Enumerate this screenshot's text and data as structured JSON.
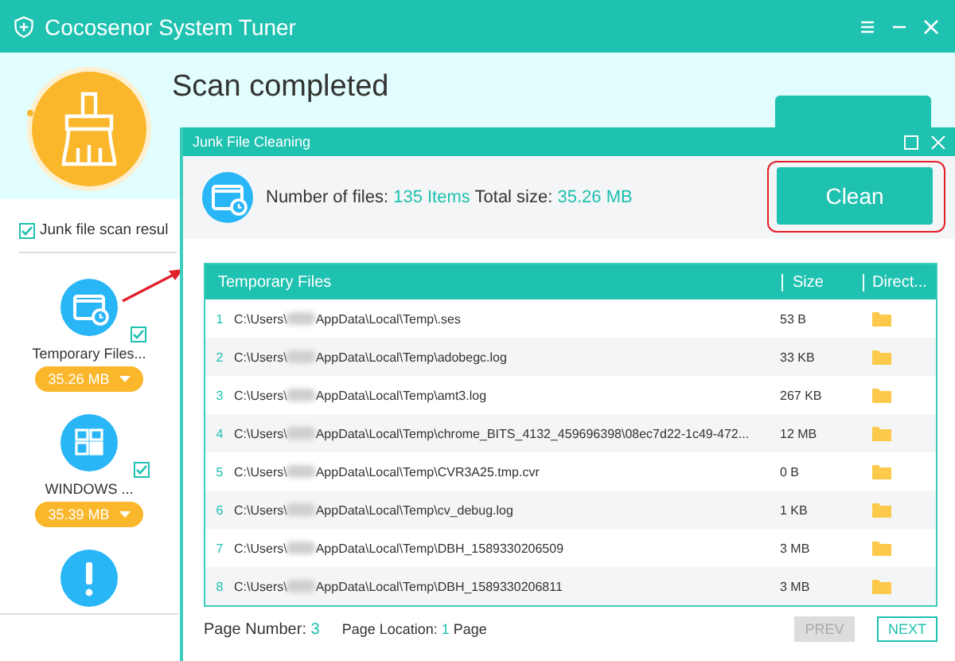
{
  "window": {
    "title": "Cocosenor System Tuner"
  },
  "header": {
    "title": "Scan completed"
  },
  "scan_results": {
    "label": "Junk file scan resul",
    "checked": true,
    "items": [
      {
        "kind": "temp",
        "label": "Temporary Files...",
        "checked": true,
        "size": "35.26 MB"
      },
      {
        "kind": "windows",
        "label": "WINDOWS ...",
        "checked": true,
        "size": "35.39 MB"
      },
      {
        "kind": "alert"
      }
    ]
  },
  "dialog": {
    "title": "Junk File Cleaning",
    "files_label": "Number of files:",
    "files_value": "135 Items",
    "size_label": "Total size:",
    "size_value": "35.26 MB",
    "clean_button": "Clean",
    "table": {
      "columns": [
        "Temporary Files",
        "Size",
        "Direct..."
      ],
      "rows": [
        {
          "index": "1",
          "path_start": "C:\\Users\\",
          "path_end": "AppData\\Local\\Temp\\.ses",
          "size": "53 B"
        },
        {
          "index": "2",
          "path_start": "C:\\Users\\",
          "path_end": "AppData\\Local\\Temp\\adobegc.log",
          "size": "33 KB"
        },
        {
          "index": "3",
          "path_start": "C:\\Users\\",
          "path_end": "AppData\\Local\\Temp\\amt3.log",
          "size": "267 KB"
        },
        {
          "index": "4",
          "path_start": "C:\\Users\\",
          "path_end": "AppData\\Local\\Temp\\chrome_BITS_4132_459696398\\08ec7d22-1c49-472...",
          "size": "12 MB"
        },
        {
          "index": "5",
          "path_start": "C:\\Users\\",
          "path_end": "AppData\\Local\\Temp\\CVR3A25.tmp.cvr",
          "size": "0 B"
        },
        {
          "index": "6",
          "path_start": "C:\\Users\\",
          "path_end": "AppData\\Local\\Temp\\cv_debug.log",
          "size": "1 KB"
        },
        {
          "index": "7",
          "path_start": "C:\\Users\\",
          "path_end": "AppData\\Local\\Temp\\DBH_1589330206509",
          "size": "3 MB"
        },
        {
          "index": "8",
          "path_start": "C:\\Users\\",
          "path_end": "AppData\\Local\\Temp\\DBH_1589330206811",
          "size": "3 MB"
        }
      ]
    },
    "footer": {
      "page_number_label": "Page Number:",
      "page_number": "3",
      "page_location_label": "Page Location:",
      "page_location": "1",
      "page_location_suffix": "Page",
      "prev": {
        "label": "PREV",
        "disabled": true
      },
      "next": {
        "label": "NEXT",
        "disabled": false
      }
    }
  }
}
